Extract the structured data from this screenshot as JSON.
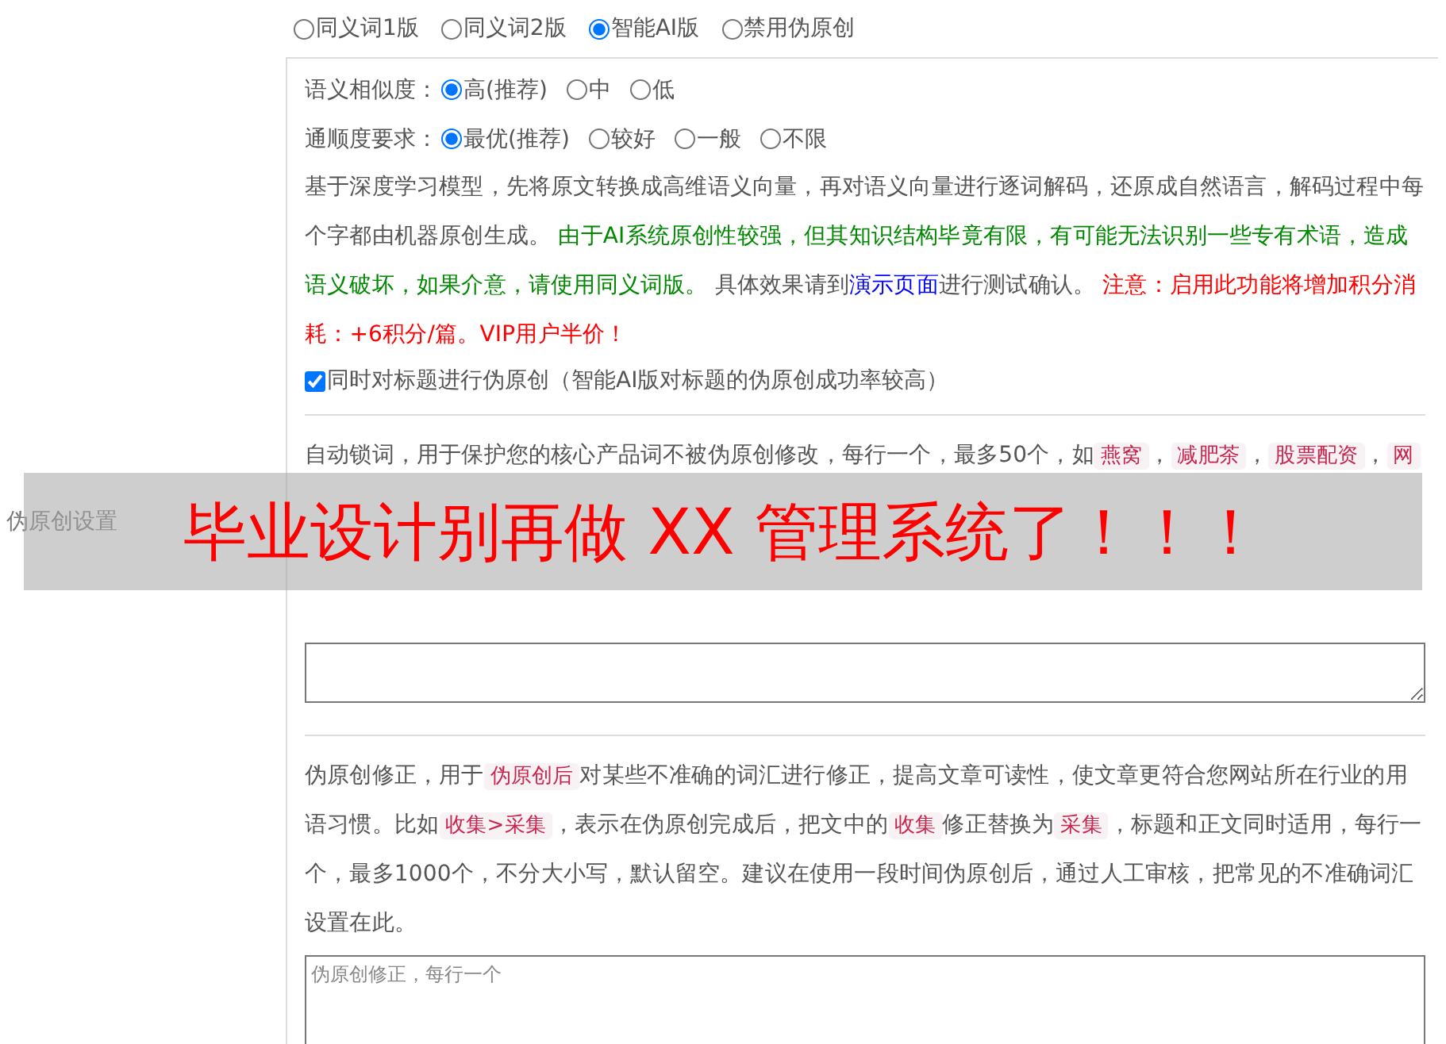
{
  "settings_label": "伪原创设置",
  "mode_options": [
    {
      "label": "同义词1版",
      "selected": false
    },
    {
      "label": "同义词2版",
      "selected": false
    },
    {
      "label": "智能AI版",
      "selected": true
    },
    {
      "label": "禁用伪原创",
      "selected": false
    }
  ],
  "similarity": {
    "label": "语义相似度：",
    "options": [
      {
        "label": "高(推荐)",
        "selected": true
      },
      {
        "label": "中",
        "selected": false
      },
      {
        "label": "低",
        "selected": false
      }
    ]
  },
  "fluency": {
    "label": "通顺度要求：",
    "options": [
      {
        "label": "最优(推荐)",
        "selected": true
      },
      {
        "label": "较好",
        "selected": false
      },
      {
        "label": "一般",
        "selected": false
      },
      {
        "label": "不限",
        "selected": false
      }
    ]
  },
  "description": [
    {
      "kind": "text",
      "text": "基于深度学习模型，先将原文转换成高维语义向量，再对语义向量进行逐词解码，还原成自然语言，解码过程中每个字都由机器原创生成。 "
    },
    {
      "kind": "green",
      "text": "由于AI系统原创性较强，但其知识结构毕竟有限，有可能无法识别一些专有术语，造成语义破坏，如果介意，请使用同义词版。"
    },
    {
      "kind": "text",
      "text": " 具体效果请到"
    },
    {
      "kind": "link",
      "text": "演示页面"
    },
    {
      "kind": "text",
      "text": "进行测试确认。 "
    },
    {
      "kind": "red",
      "text": "注意：启用此功能将增加积分消耗：+6积分/篇。VIP用户半价！"
    }
  ],
  "title_option": {
    "label": "同时对标题进行伪原创（智能AI版对标题的伪原创成功率较高）",
    "checked": true
  },
  "lock_words": {
    "description": [
      {
        "kind": "text",
        "text": "自动锁词，用于保护您的核心产品词不被伪原创修改，每行一个，最多50个，如"
      },
      {
        "kind": "code",
        "text": "燕窝"
      },
      {
        "kind": "text",
        "text": "，"
      },
      {
        "kind": "code",
        "text": "减肥茶"
      },
      {
        "kind": "text",
        "text": "，"
      },
      {
        "kind": "code",
        "text": "股票配资"
      },
      {
        "kind": "text",
        "text": "，"
      },
      {
        "kind": "code",
        "text": "网"
      }
    ]
  },
  "correction": {
    "description": [
      {
        "kind": "text",
        "text": "伪原创修正，用于"
      },
      {
        "kind": "code",
        "text": "伪原创后"
      },
      {
        "kind": "text",
        "text": "对某些不准确的词汇进行修正，提高文章可读性，使文章更符合您网站所在行业的用语习惯。比如"
      },
      {
        "kind": "code",
        "text": "收集>采集"
      },
      {
        "kind": "text",
        "text": "，表示在伪原创完成后，把文中的"
      },
      {
        "kind": "code",
        "text": "收集"
      },
      {
        "kind": "text",
        "text": "修正替换为"
      },
      {
        "kind": "code",
        "text": "采集"
      },
      {
        "kind": "text",
        "text": "，标题和正文同时适用，每行一个，最多1000个，不分大小写，默认留空。建议在使用一段时间伪原创后，通过人工审核，把常见的不准确词汇设置在此。"
      }
    ],
    "placeholder": "伪原创修正，每行一个"
  },
  "banner": {
    "text": "毕业设计别再做 XX 管理系统了！！！"
  }
}
